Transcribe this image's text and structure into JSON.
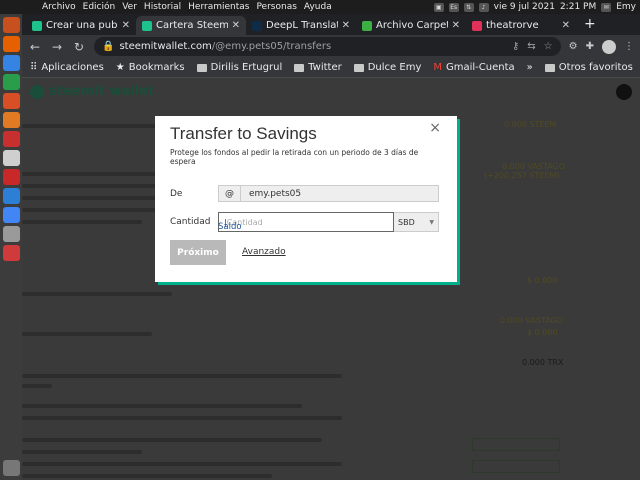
{
  "topbar": {
    "menu": [
      "Archivo",
      "Edición",
      "Ver",
      "Historial",
      "Herramientas",
      "Personas",
      "Ayuda"
    ],
    "date": "vie 9 jul 2021",
    "time": "2:21 PM",
    "user": "Emy",
    "keyboard": "Es"
  },
  "tabs": [
    {
      "title": "Crear una publica",
      "color": "#1ec28b"
    },
    {
      "title": "Cartera Steemit",
      "color": "#1ec28b"
    },
    {
      "title": "DeepL Translate:",
      "color": "#0f2b46"
    },
    {
      "title": "Archivo Carpeta",
      "color": "#3cb043"
    },
    {
      "title": "theatrorve",
      "color": "#e0315a"
    }
  ],
  "active_tab": 1,
  "toolbar": {
    "url_host": "steemitwallet.com",
    "url_path": "/@emy.pets05/transfers"
  },
  "bookmarks": {
    "items": [
      "Aplicaciones",
      "Bookmarks",
      "Dirilis Ertugrul",
      "Twitter",
      "Dulce Emy",
      "Gmail-Cuenta"
    ],
    "right": "Otros favoritos"
  },
  "page": {
    "logo": "steemit wallet",
    "values": [
      "0.000 STEEM",
      "0.000 VASTAGO",
      "(+200.257 STEEM)",
      "$ 0.000",
      "0.000 VASTAGO",
      "$ 0.000",
      "0.000 TRX"
    ]
  },
  "modal": {
    "title": "Transfer to Savings",
    "subtitle": "Protege los fondos al pedir la retirada con un periodo de 3 días de espera",
    "from_label": "De",
    "from_at": "@",
    "from_value": "emy.pets05",
    "amount_label": "Cantidad",
    "amount_placeholder": "Cantidad",
    "currency": "SBD",
    "saldo": "Saldo",
    "primary_btn": "Próximo",
    "secondary_btn": "Avanzado",
    "close": "×"
  }
}
